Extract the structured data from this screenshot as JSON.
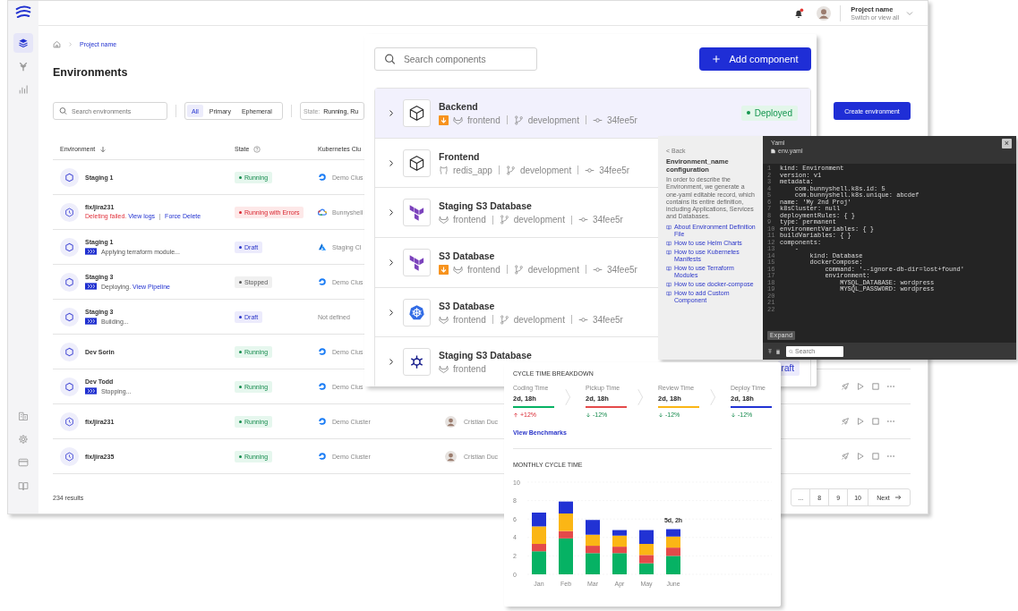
{
  "app_window": {
    "topbar": {
      "has_unread": true,
      "project_name": "Project name",
      "project_hint": "Switch or view all"
    },
    "sidebar": {
      "items": [
        {
          "kind": "environments",
          "selected": true
        },
        {
          "kind": "templates",
          "selected": false
        },
        {
          "kind": "analytics",
          "selected": false
        }
      ],
      "bottom_items": [
        {
          "kind": "organization"
        },
        {
          "kind": "settings"
        },
        {
          "kind": "billing"
        },
        {
          "kind": "docs"
        }
      ]
    },
    "breadcrumb": "Project name",
    "title": "Environments",
    "search": {
      "placeholder": "Search environments"
    },
    "segments": [
      {
        "label": "All",
        "selected": true
      },
      {
        "label": "Primary",
        "selected": false
      },
      {
        "label": "Ephemeral",
        "selected": false
      }
    ],
    "state_filter": {
      "label": "State:",
      "value": "Running, Ru"
    },
    "create_button": "Create environment",
    "table": {
      "columns": [
        {
          "label": "Environment",
          "kind": "sorted"
        },
        {
          "label": "State",
          "kind": "help"
        },
        {
          "label": "Kubernetes Clu",
          "kind": "plain"
        }
      ],
      "rows": [
        {
          "name": "Staging 1",
          "kind": "primary",
          "status": {
            "kind": "running",
            "text": "Running"
          },
          "cluster": {
            "kind": "digitalocean",
            "text": "Demo Clus"
          }
        },
        {
          "name": "fix/jira231",
          "kind": "ephemeral",
          "activity": {
            "progress": false,
            "parts": [
              {
                "kind": "error",
                "text": "Deleting failed."
              },
              {
                "kind": "link",
                "text": "View logs"
              },
              {
                "kind": "divider"
              },
              {
                "kind": "link",
                "text": "Force Delete"
              }
            ]
          },
          "status": {
            "kind": "error",
            "text": "Running with Errors"
          },
          "cluster": {
            "kind": "gcp",
            "text": "Bunnyshell"
          }
        },
        {
          "name": "Staging 1",
          "kind": "primary",
          "activity": {
            "progress": true,
            "parts": [
              {
                "kind": "text",
                "text": "Applying terraform module..."
              }
            ]
          },
          "status": {
            "kind": "draft",
            "text": "Draft"
          },
          "cluster": {
            "kind": "azure",
            "text": "Staging Cl"
          }
        },
        {
          "name": "Staging 3",
          "kind": "primary",
          "activity": {
            "progress": true,
            "parts": [
              {
                "kind": "text",
                "text": "Deploying."
              },
              {
                "kind": "link",
                "text": "View Pipeline"
              }
            ]
          },
          "status": {
            "kind": "stopped",
            "text": "Stopped"
          },
          "cluster": {
            "kind": "digitalocean",
            "text": "Demo Clus"
          }
        },
        {
          "name": "Staging 3",
          "kind": "primary",
          "activity": {
            "progress": true,
            "parts": [
              {
                "kind": "text",
                "text": "Building..."
              }
            ]
          },
          "status": {
            "kind": "draft",
            "text": "Draft"
          },
          "cluster": {
            "kind": "none",
            "text": "Not defined"
          }
        },
        {
          "name": "Dev Sorin",
          "kind": "primary",
          "status": {
            "kind": "running",
            "text": "Running"
          },
          "cluster": {
            "kind": "digitalocean",
            "text": "Demo Clus"
          }
        },
        {
          "name": "Dev Todd",
          "kind": "primary",
          "activity": {
            "progress": true,
            "parts": [
              {
                "kind": "text",
                "text": "Stopping..."
              }
            ]
          },
          "status": {
            "kind": "running",
            "text": "Running"
          },
          "cluster": {
            "kind": "digitalocean",
            "text": "Demo Clus"
          },
          "actions": true
        },
        {
          "name": "fix/jira231",
          "kind": "ephemeral",
          "status": {
            "kind": "running",
            "text": "Running"
          },
          "cluster": {
            "kind": "digitalocean",
            "text": "Demo Cluster"
          },
          "owner": "Cristian Duc",
          "actions": true
        },
        {
          "name": "fix/jira235",
          "kind": "ephemeral",
          "status": {
            "kind": "running",
            "text": "Running"
          },
          "cluster": {
            "kind": "digitalocean",
            "text": "Demo Cluster"
          },
          "owner": "Cristian Duc",
          "actions": true
        }
      ]
    },
    "results": "234 results",
    "pagination": [
      {
        "label": "..."
      },
      {
        "label": "8"
      },
      {
        "label": "9"
      },
      {
        "label": "10"
      },
      {
        "label": "Next",
        "kind": "next"
      }
    ]
  },
  "components_panel": {
    "search": {
      "placeholder": "Search components"
    },
    "add_button": "Add component",
    "rows": [
      {
        "name": "Backend",
        "kind": "application",
        "selected": true,
        "download": true,
        "repo": {
          "kind": "gitlab",
          "name": "frontend"
        },
        "branch": "development",
        "commit": "34fee5r",
        "status": {
          "kind": "deployed",
          "text": "Deployed"
        }
      },
      {
        "name": "Frontend",
        "kind": "application",
        "selected": false,
        "download": false,
        "repo": {
          "kind": "github",
          "name": "redis_app"
        },
        "branch": "development",
        "commit": "34fee5r"
      },
      {
        "name": "Staging S3 Database",
        "kind": "terraform",
        "selected": false,
        "download": false,
        "repo": {
          "kind": "gitlab",
          "name": "frontend"
        },
        "branch": "development",
        "commit": "34fee5r"
      },
      {
        "name": "S3 Database",
        "kind": "terraform",
        "selected": false,
        "download": true,
        "repo": {
          "kind": "gitlab",
          "name": "frontend"
        },
        "branch": "development",
        "commit": "34fee5r"
      },
      {
        "name": "S3 Database",
        "kind": "kubernetes",
        "selected": false,
        "download": false,
        "repo": {
          "kind": "gitlab",
          "name": "frontend"
        },
        "branch": "development",
        "commit": "34fee5r"
      },
      {
        "name": "Staging S3 Database",
        "kind": "helm",
        "selected": false,
        "download": false,
        "repo": {
          "kind": "gitlab",
          "name": "frontend"
        },
        "status": {
          "kind": "draft",
          "text": "raft"
        }
      }
    ]
  },
  "config_panel": {
    "back": "< Back",
    "title": "Environment_name configuration",
    "description": "In order to describe the Environment, we generate a one-yaml editable record, which contains its entire definition, including Applications, Services and Databases.",
    "links": [
      "About Environment Definition File",
      "How to use Helm Charts",
      "How to use Kubernetes Manifests",
      "How to use Terraform Modules",
      "How to use docker-compose",
      "How to add Custom Component"
    ],
    "file_type": "Yaml",
    "file_name": "env.yaml",
    "close": "×",
    "lines": [
      {
        "n": "1",
        "code": "kind: Environment"
      },
      {
        "n": "2",
        "code": "version: v1"
      },
      {
        "n": "3",
        "code": "metadata:"
      },
      {
        "n": "4",
        "code": "    com.bunnyshell.k8s.id: 5"
      },
      {
        "n": "5",
        "code": "    com.bunnyshell.k8s.unique: abcdef"
      },
      {
        "n": "6",
        "code": "name: 'My 2nd Proj'"
      },
      {
        "n": "7",
        "code": "k8sCluster: null"
      },
      {
        "n": "8",
        "code": "deploymentRules: { }"
      },
      {
        "n": "9",
        "code": "type: permanent"
      },
      {
        "n": "10",
        "code": "environmentVariables: { }"
      },
      {
        "n": "11",
        "code": "buildVariables: { }"
      },
      {
        "n": "12",
        "code": "components:"
      },
      {
        "n": "13",
        "code": "    -"
      },
      {
        "n": "14",
        "code": "        kind: Database"
      },
      {
        "n": "15",
        "code": "        dockerCompose:"
      },
      {
        "n": "16",
        "code": "            command: '--ignore-db-dir=lost+found'"
      },
      {
        "n": "17",
        "code": "            environment:"
      },
      {
        "n": "18",
        "code": "                MYSQL_DATABASE: wordpress"
      },
      {
        "n": "19",
        "code": "                MYSQL_PASSWORD: wordpress"
      },
      {
        "n": "20"
      },
      {
        "n": "21"
      },
      {
        "n": "22"
      }
    ],
    "expand": "Expand",
    "search_placeholder": "Search"
  },
  "cycle_time_panel": {
    "title": "CYCLE TIME BREAKDOWN",
    "stages": [
      {
        "label": "Coding Time",
        "value": "2d, 18h",
        "color": "#06b264",
        "kind": "increase",
        "delta": "+12%"
      },
      {
        "label": "Pickup Time",
        "value": "2d, 18h",
        "color": "#e44a4a",
        "kind": "decrease",
        "delta": "-12%"
      },
      {
        "label": "Review Time",
        "value": "2d, 18h",
        "color": "#fbb615",
        "kind": "decrease",
        "delta": "-12%"
      },
      {
        "label": "Deploy Time",
        "value": "2d, 18h",
        "color": "#2132d4",
        "kind": "decrease",
        "delta": "-12%"
      }
    ],
    "link": "View Benchmarks",
    "chart_title": "MONTHLY CYCLE TIME",
    "chart_data": {
      "type": "bar",
      "stacked": true,
      "grid": true,
      "categories": [
        "Jan",
        "Feb",
        "Mar",
        "Apr",
        "May",
        "June"
      ],
      "series": [
        {
          "color": "#06b264",
          "values": [
            2.5,
            3.9,
            2.3,
            2.3,
            1.2,
            2.0
          ]
        },
        {
          "color": "#e44a4a",
          "values": [
            0.8,
            0.8,
            0.8,
            0.7,
            0.9,
            0.9
          ]
        },
        {
          "color": "#fbb615",
          "values": [
            1.9,
            1.9,
            1.2,
            1.2,
            1.2,
            1.2
          ]
        },
        {
          "color": "#2132d4",
          "values": [
            1.5,
            1.3,
            1.6,
            0.6,
            1.5,
            0.8
          ]
        }
      ],
      "ylim": [
        0,
        10
      ],
      "yticks": [
        {
          "value": 0,
          "label": "0"
        },
        {
          "value": 2,
          "label": "2"
        },
        {
          "value": 4,
          "label": "4"
        },
        {
          "value": 6,
          "label": "6"
        },
        {
          "value": 8,
          "label": "8"
        },
        {
          "value": 10,
          "label": "10"
        }
      ],
      "annotations": [
        "5d, 2h"
      ]
    }
  }
}
